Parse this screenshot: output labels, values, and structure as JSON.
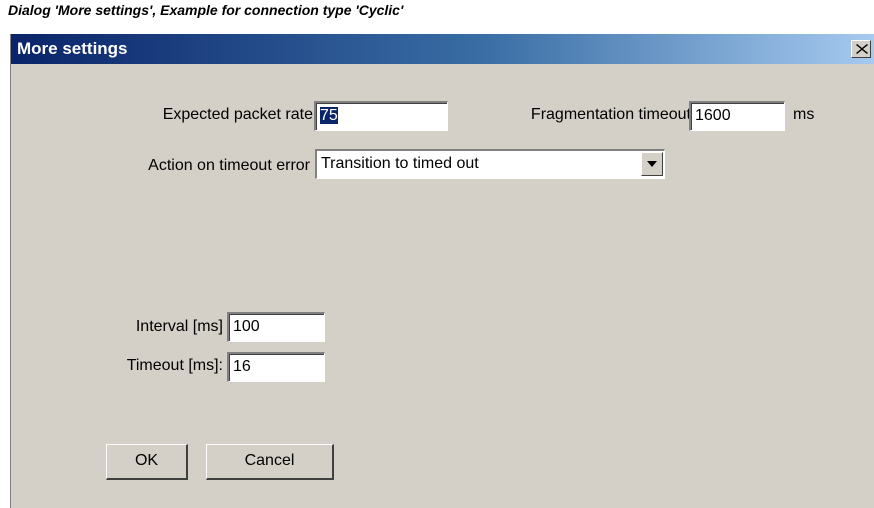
{
  "caption": "Dialog 'More settings', Example for connection type 'Cyclic'",
  "dialog": {
    "title": "More settings",
    "close_glyph": "×"
  },
  "fields": {
    "expected_packet_rate": {
      "label": "Expected packet rate",
      "value": "75"
    },
    "fragmentation_timeout": {
      "label": "Fragmentation timeout",
      "value": "1600",
      "unit": "ms"
    },
    "action_on_timeout": {
      "label": "Action on timeout error",
      "value": "Transition to timed out"
    },
    "interval": {
      "label": "Interval [ms]",
      "value": "100"
    },
    "timeout": {
      "label": "Timeout [ms]:",
      "value": "16"
    }
  },
  "buttons": {
    "ok": "OK",
    "cancel": "Cancel"
  },
  "colors": {
    "title_gradient_start": "#0a246a",
    "title_gradient_end": "#a6caf0",
    "dialog_bg": "#d4d0c8",
    "selection": "#0a246a"
  }
}
